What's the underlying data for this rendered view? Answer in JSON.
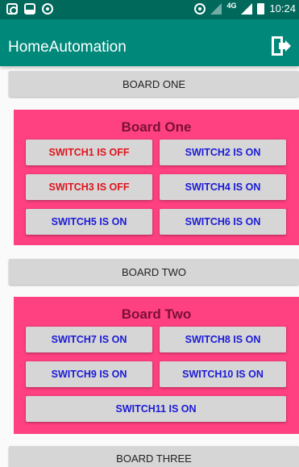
{
  "status_bar": {
    "network": "4G",
    "time": "10:24"
  },
  "app_bar": {
    "title": "HomeAutomation",
    "logout_icon": "logout-icon"
  },
  "boards": [
    {
      "button_label": "BOARD ONE",
      "title": "Board One",
      "switches": [
        {
          "label": "SWITCH1 IS OFF",
          "state": "off"
        },
        {
          "label": "SWITCH2 IS ON",
          "state": "on"
        },
        {
          "label": "SWITCH3 IS OFF",
          "state": "off"
        },
        {
          "label": "SWITCH4 IS ON",
          "state": "on"
        },
        {
          "label": "SWITCH5 IS ON",
          "state": "on"
        },
        {
          "label": "SWITCH6 IS ON",
          "state": "on"
        }
      ]
    },
    {
      "button_label": "BOARD TWO",
      "title": "Board Two",
      "switches": [
        {
          "label": "SWITCH7 IS ON",
          "state": "on"
        },
        {
          "label": "SWITCH8 IS ON",
          "state": "on"
        },
        {
          "label": "SWITCH9 IS ON",
          "state": "on"
        },
        {
          "label": "SWITCH10 IS ON",
          "state": "on"
        },
        {
          "label": "SWITCH11 IS ON",
          "state": "on"
        }
      ]
    },
    {
      "button_label": "BOARD THREE"
    }
  ],
  "colors": {
    "primary_dark": "#00695c",
    "primary": "#00897b",
    "accent": "#ff4081",
    "off_text": "#e0141e",
    "on_text": "#1a1ad6"
  }
}
